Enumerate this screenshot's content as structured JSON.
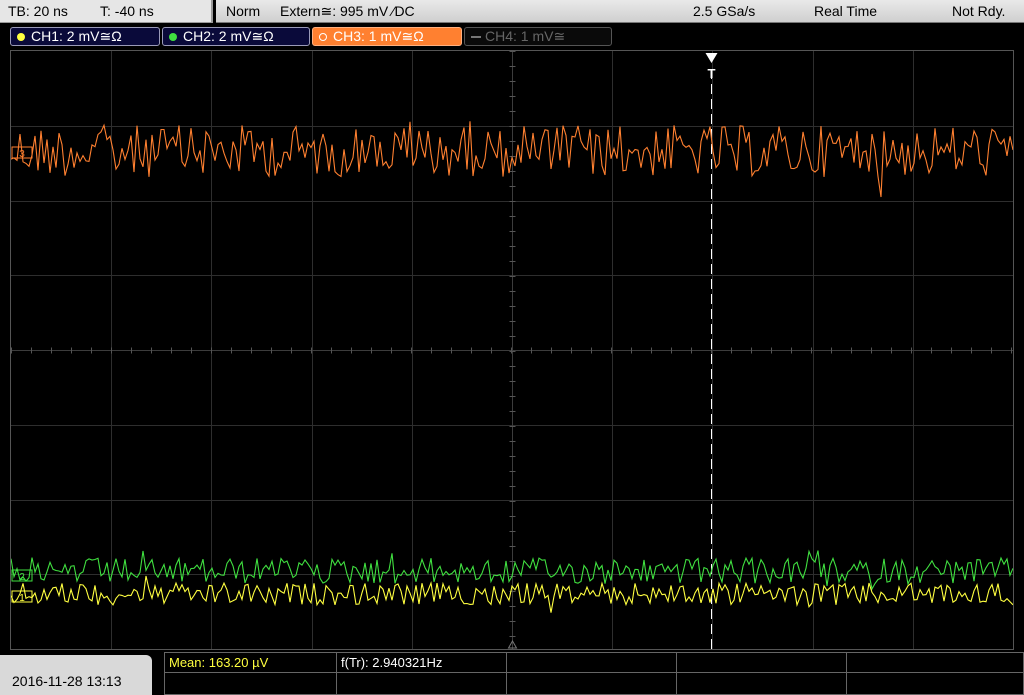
{
  "status": {
    "timebase": "TB: 20 ns",
    "trigger_offset": "T: -40 ns",
    "mode": "Norm",
    "trigger_source": "Extern≅: 995 mV ⁄DC",
    "sample_rate": "2.5 GSa/s",
    "acquisition": "Real Time",
    "state": "Not Rdy."
  },
  "channels": [
    {
      "label": "CH1: 2 mV≅Ω",
      "color": "#ffff40",
      "active": false,
      "enabled": true
    },
    {
      "label": "CH2: 2 mV≅Ω",
      "color": "#40e040",
      "active": false,
      "enabled": true
    },
    {
      "label": "CH3: 1 mV≅Ω",
      "color": "#ff8030",
      "active": true,
      "enabled": true
    },
    {
      "label": "CH4: 1 mV≅",
      "color": "#777777",
      "active": false,
      "enabled": false
    }
  ],
  "trace_markers": {
    "ch3": "3",
    "ch2": "2",
    "ch1": "1"
  },
  "trigger_marker": "T",
  "datetime": "2016-11-28 13:13",
  "measurements": {
    "mean": "Mean: 163.20 µV",
    "freq": "f(Tr): 2.940321Hz"
  }
}
